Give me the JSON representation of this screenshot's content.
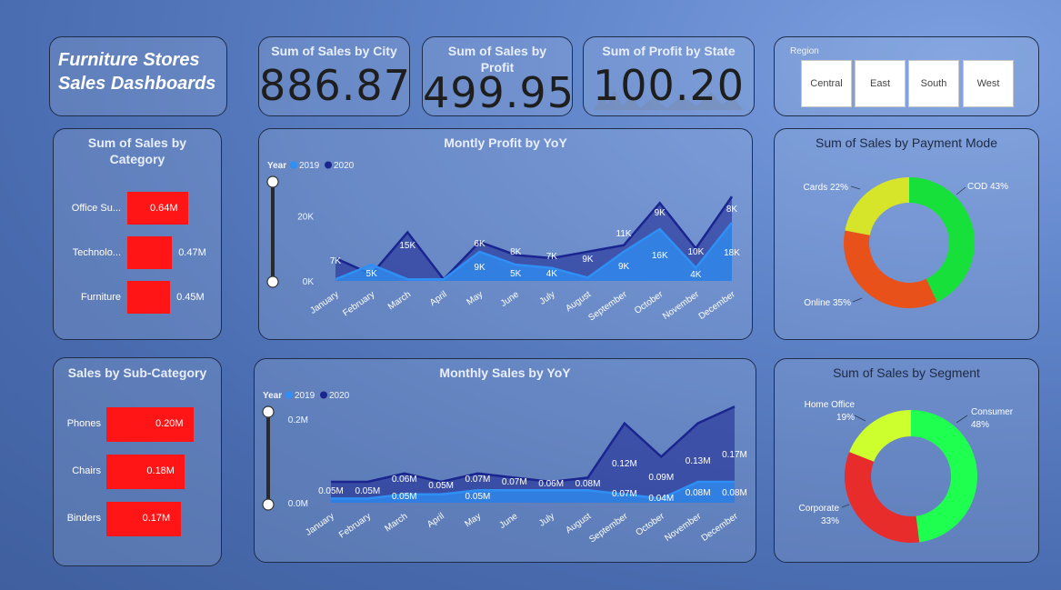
{
  "dashboard_title_line1": "Furniture Stores",
  "dashboard_title_line2": "Sales Dashboards",
  "kpis": [
    {
      "title": "Sum of Sales by City",
      "value": "886.87"
    },
    {
      "title": "Sum of Sales by Profit",
      "value": "499.95"
    },
    {
      "title": "Sum of Profit by State",
      "value": "100.20"
    }
  ],
  "region_slicer": {
    "label": "Region",
    "options": [
      "Central",
      "East",
      "South",
      "West"
    ]
  },
  "colors": {
    "bar_red": "#ff1515",
    "series_2019": "#2f8ff5",
    "series_2020": "#1a2590",
    "donut_green": "#17e03a",
    "donut_orange": "#e8521a",
    "donut_yellow": "#d6e42a",
    "donut_red": "#e82b2b",
    "donut_lime": "#cdff2e",
    "donut_bright_green": "#1fff4f"
  },
  "chart_data": [
    {
      "id": "category",
      "type": "bar",
      "title": "Sum of Sales by Category",
      "categories": [
        "Office Su...",
        "Technolo...",
        "Furniture"
      ],
      "values": [
        0.64,
        0.47,
        0.45
      ],
      "value_labels": [
        "0.64M",
        "0.47M",
        "0.45M"
      ]
    },
    {
      "id": "subcategory",
      "type": "bar",
      "title": "Sales by Sub-Category",
      "categories": [
        "Phones",
        "Chairs",
        "Binders"
      ],
      "values": [
        0.2,
        0.18,
        0.17
      ],
      "value_labels": [
        "0.20M",
        "0.18M",
        "0.17M"
      ]
    },
    {
      "id": "profit",
      "type": "area",
      "title": "Montly Profit by YoY",
      "legend_title": "Year",
      "legend_position": "top-left",
      "categories": [
        "January",
        "February",
        "March",
        "April",
        "May",
        "June",
        "July",
        "August",
        "September",
        "October",
        "November",
        "December"
      ],
      "y_ticks": [
        "0K",
        "20K"
      ],
      "ylim": [
        0,
        30000
      ],
      "series": [
        {
          "name": "2019",
          "values": [
            500,
            5000,
            500,
            500,
            9000,
            5000,
            4000,
            1000,
            9000,
            16000,
            4000,
            18000
          ],
          "labels": [
            "",
            "5K",
            "",
            "",
            "9K",
            "5K",
            "4K",
            "",
            "9K",
            "16K",
            "4K",
            "18K"
          ]
        },
        {
          "name": "2020",
          "values": [
            7000,
            2000,
            15000,
            500,
            12000,
            8000,
            7000,
            9000,
            11000,
            24000,
            10000,
            26000
          ],
          "labels": [
            "7K",
            "",
            "15K",
            "",
            "6K",
            "8K",
            "7K",
            "9K",
            "11K",
            "9K",
            "10K",
            "8K"
          ]
        }
      ]
    },
    {
      "id": "sales",
      "type": "area",
      "title": "Monthly Sales by YoY",
      "legend_title": "Year",
      "legend_position": "top-left",
      "categories": [
        "January",
        "February",
        "March",
        "April",
        "May",
        "June",
        "July",
        "August",
        "September",
        "October",
        "November",
        "December"
      ],
      "y_ticks": [
        "0.0M",
        "0.2M"
      ],
      "ylim": [
        0,
        0.3
      ],
      "series": [
        {
          "name": "2019",
          "values": [
            0.01,
            0.01,
            0.02,
            0.02,
            0.03,
            0.03,
            0.03,
            0.03,
            0.02,
            0.01,
            0.05,
            0.05
          ],
          "labels": [
            "",
            "",
            "0.05M",
            "",
            "0.05M",
            "",
            "",
            "",
            "0.07M",
            "0.04M",
            "0.08M",
            "0.08M"
          ]
        },
        {
          "name": "2020",
          "values": [
            0.05,
            0.05,
            0.07,
            0.05,
            0.07,
            0.06,
            0.05,
            0.06,
            0.19,
            0.11,
            0.19,
            0.23
          ],
          "labels": [
            "0.05M",
            "0.05M",
            "0.06M",
            "0.05M",
            "0.07M",
            "0.07M",
            "0.06M",
            "0.08M",
            "0.12M",
            "0.09M",
            "0.13M",
            "0.17M"
          ]
        }
      ]
    },
    {
      "id": "payment",
      "type": "pie",
      "title": "Sum of Sales by Payment Mode",
      "labels": [
        "COD 43%",
        "Online 35%",
        "Cards 22%"
      ],
      "values": [
        43,
        35,
        22
      ]
    },
    {
      "id": "segment",
      "type": "pie",
      "title": "Sum of Sales by Segment",
      "labels": [
        "Consumer",
        "Corporate",
        "Home Office"
      ],
      "label_lines": [
        [
          "Consumer",
          "48%"
        ],
        [
          "Corporate",
          "33%"
        ],
        [
          "Home Office",
          "19%"
        ]
      ],
      "values": [
        48,
        33,
        19
      ]
    }
  ]
}
